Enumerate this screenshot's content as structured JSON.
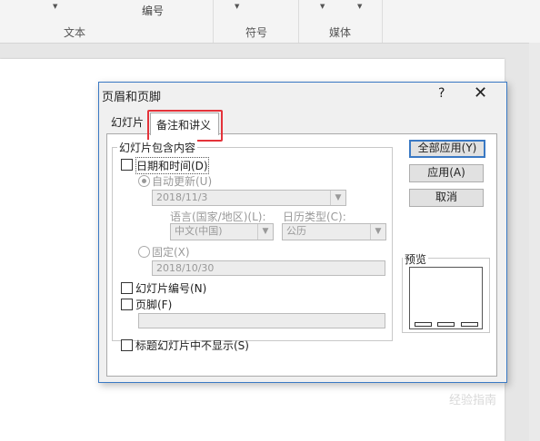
{
  "ribbon": {
    "top_text": "编号",
    "groups": [
      "文本",
      "符号",
      "媒体"
    ]
  },
  "dialog": {
    "title": "页眉和页脚",
    "help": "?",
    "close": "✕",
    "tabs": [
      "幻灯片",
      "备注和讲义"
    ],
    "group_label": "幻灯片包含内容",
    "date_time": "日期和时间(D)",
    "auto_update": "自动更新(U)",
    "auto_date": "2018/11/3",
    "language_label": "语言(国家/地区)(L):",
    "calendar_label": "日历类型(C):",
    "language_value": "中文(中国)",
    "calendar_value": "公历",
    "fixed": "固定(X)",
    "fixed_date": "2018/10/30",
    "slide_number": "幻灯片编号(N)",
    "footer": "页脚(F)",
    "footer_value": "",
    "no_title": "标题幻灯片中不显示(S)",
    "buttons": {
      "apply_all": "全部应用(Y)",
      "apply": "应用(A)",
      "cancel": "取消"
    },
    "preview_label": "预览"
  },
  "watermark": "经验指南"
}
